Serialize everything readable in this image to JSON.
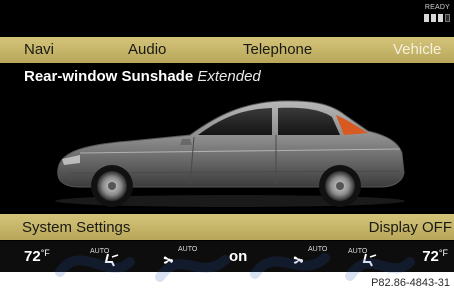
{
  "status": {
    "ready_label": "READY",
    "signal_level": "3 of 4"
  },
  "main_menu": {
    "items": [
      {
        "label": "Navi",
        "active": false
      },
      {
        "label": "Audio",
        "active": false
      },
      {
        "label": "Telephone",
        "active": false
      },
      {
        "label": "Vehicle",
        "active": true
      }
    ],
    "active_color": "#f4f0dc",
    "bar_color": "#c8b86a"
  },
  "content": {
    "setting_label": "Rear-window Sunshade",
    "setting_value": "Extended",
    "car_icon": "sedan-side-view-illustration",
    "sunshade_color": "#d85a20"
  },
  "sub_menu": {
    "left_label": "System Settings",
    "right_label": "Display OFF"
  },
  "climate": {
    "left_temp": "72",
    "right_temp": "72",
    "temp_unit": "°F",
    "auto_airflow_left": "AUTO",
    "fan_left": "AUTO",
    "center_status": "on",
    "fan_right": "AUTO",
    "auto_airflow_right": "AUTO",
    "fan_icon": "fan-icon",
    "airflow_icon": "seat-airflow-icon"
  },
  "caption": "P82.86-4843-31"
}
